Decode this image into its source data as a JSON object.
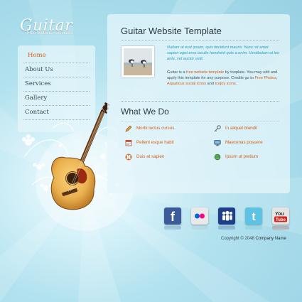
{
  "logo": {
    "title": "Guitar",
    "subtitle": "Free Website Templates"
  },
  "nav": [
    {
      "label": "Home",
      "active": true
    },
    {
      "label": "About Us"
    },
    {
      "label": "Services"
    },
    {
      "label": "Gallery"
    },
    {
      "label": "Contact"
    }
  ],
  "main": {
    "title": "Guitar Website Template",
    "intro_italic": "Nullam at erat ipsum, quis tincidunt mauris. Nunc sit amet sapien eget eros iaculis hendrerit quis a enim. Vestibulum at leo ante, vel auctor velit.",
    "intro_before": "Guitar is a ",
    "intro_link1": "free website template",
    "intro_mid": " by tooplate. You may edit and apply this template for any purpose. Credits go to ",
    "intro_link2": "Free Photos",
    "intro_comma": ", ",
    "intro_link3": "Aquaticus social icons",
    "intro_and": " and ",
    "intro_link4": "Icojoy icons",
    "intro_end": ".",
    "section_title": "What We Do",
    "features": [
      {
        "label": "Morbi luctus cursus",
        "icon": "pencil-icon"
      },
      {
        "label": "In aliquet blandit",
        "icon": "key-icon"
      },
      {
        "label": "Pellent esque habit",
        "icon": "calendar-icon"
      },
      {
        "label": "Maecenas posuere",
        "icon": "monitor-icon"
      },
      {
        "label": "Duis at sapien",
        "icon": "lifebuoy-icon"
      },
      {
        "label": "Ipsum ut pretium",
        "icon": "globe-icon"
      }
    ]
  },
  "social": [
    {
      "name": "facebook",
      "glyph": "f",
      "color": "#3b5b9a"
    },
    {
      "name": "flickr",
      "glyph": "••",
      "color": "#dcdcdc"
    },
    {
      "name": "myspace",
      "glyph": "♟♟",
      "color": "#1f3f8a"
    },
    {
      "name": "twitter",
      "glyph": "t",
      "color": "#5cc3e3"
    },
    {
      "name": "youtube",
      "glyph": "You",
      "color": "#d9d9d9"
    }
  ],
  "footer": {
    "prefix": "Copyright © 2048 ",
    "company": "Company Name"
  }
}
